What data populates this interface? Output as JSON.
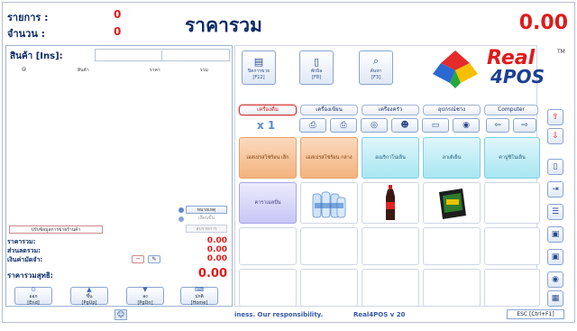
{
  "header": {
    "items_label": "รายการ :",
    "items_value": "0",
    "qty_label": "จำนวน :",
    "qty_value": "0",
    "title": "ราคารวม",
    "total": "0.00"
  },
  "product": {
    "label": "สินค้า [Ins]:",
    "col_no": "@",
    "col_name": "สินค้า",
    "col_price": "ราคา",
    "col_sum": "รวม"
  },
  "buttons": {
    "note": "หมายเหตุ",
    "move_up": "เลื่อนขึ้น",
    "move_down": "ลบรายการ",
    "adjust": "ปรับข้อมูลการขายร้านค้า"
  },
  "summary": {
    "total_label": "ราคารวม:",
    "total_value": "0.00",
    "discount_label": "ส่วนลดรวม:",
    "discount_value": "0.00",
    "received_label": "เงินค่ามัดจำ:",
    "received_value": "0.00",
    "net_label": "ราคารวมสุทธิ:",
    "net_value": "0.00"
  },
  "fkeys": [
    {
      "top": "ออก",
      "sub": "[End]"
    },
    {
      "top": "ขึ้น",
      "sub": "[PgUp]"
    },
    {
      "top": "ลง",
      "sub": "[PgDn]"
    },
    {
      "top": "ปกติ",
      "sub": "[Home]"
    }
  ],
  "toolbar": [
    {
      "label": "ปิดการขาย",
      "key": "[F12]"
    },
    {
      "label": "พักบิล",
      "key": "[F8]"
    },
    {
      "label": "ค้นหา",
      "key": "[F3]"
    }
  ],
  "brand": {
    "logo_top": "Real",
    "logo_bottom": "4POS",
    "tm": "TM"
  },
  "categories": [
    "เครื่องดื่ม",
    "เครื่องเขียน",
    "เครื่องครัว",
    "อุปกรณ์ช่าง",
    "Computer"
  ],
  "multiplier": "x 1",
  "tiles_row1": [
    "เอสเปรสโซ่ร้อน เล็ก",
    "เอสเปรสโซ่ร้อน กลาง",
    "อเมริกาโน่เย็น",
    "ลาเต้เย็น",
    "คาปูชิโน่เย็น"
  ],
  "tiles_row2": [
    "คาราเมลปั่น"
  ],
  "status": {
    "ticker": "iness. Our responsibility.",
    "version": "Real4POS v 20",
    "exit": "ESC [Ctrl+F1]"
  },
  "colors": {
    "accent_red": "#e01a1a",
    "navy": "#0b2a66"
  }
}
